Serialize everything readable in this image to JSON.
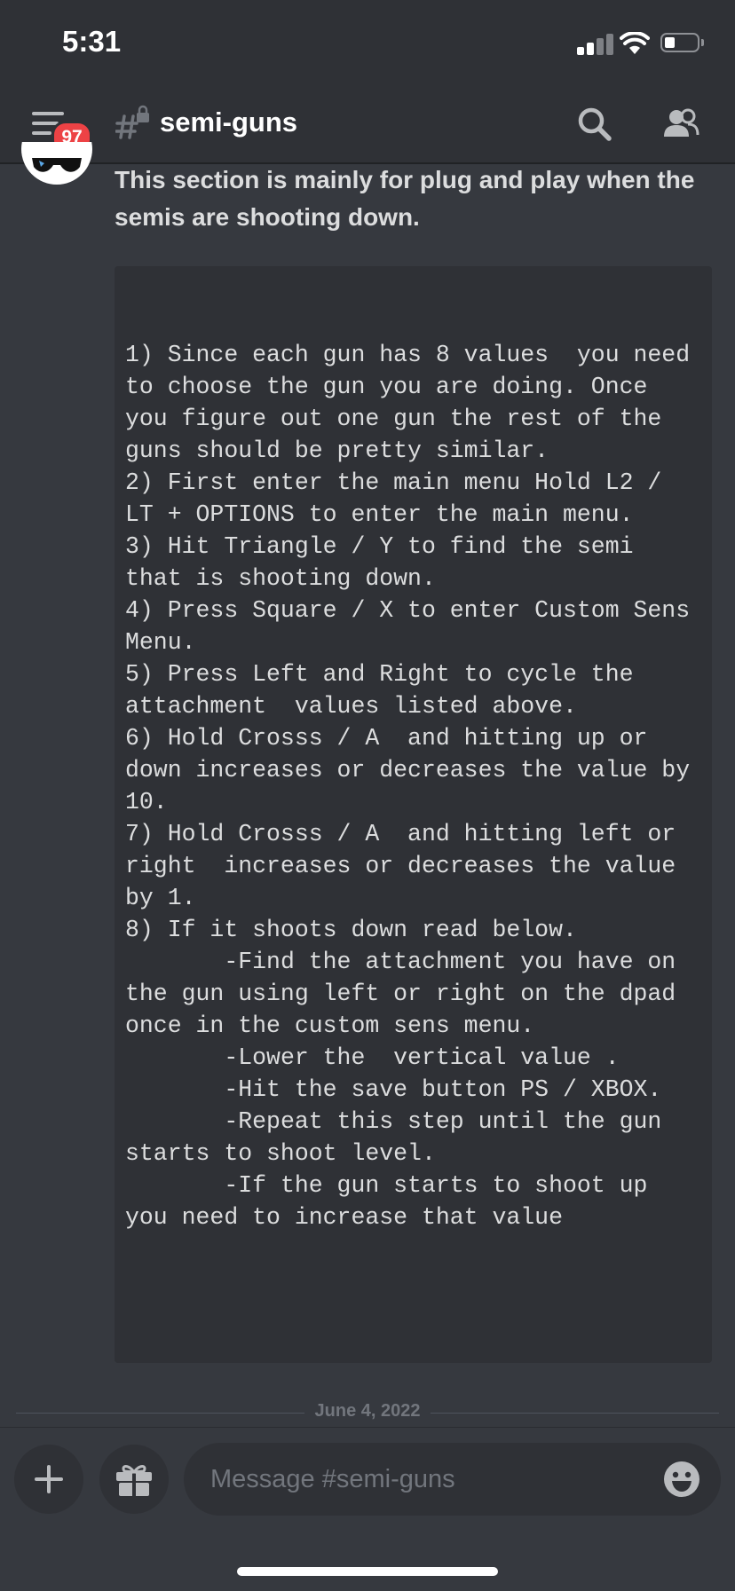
{
  "status_bar": {
    "time": "5:31"
  },
  "header": {
    "notification_count": "97",
    "channel_name": "semi-guns"
  },
  "message": {
    "text": "This section is mainly for plug and play when the semis are shooting down.",
    "code": "1) Since each gun has 8 values  you need to choose the gun you are doing. Once you figure out one gun the rest of the guns should be pretty similar.\n2) First enter the main menu Hold L2 / LT + OPTIONS to enter the main menu.\n3) Hit Triangle / Y to find the semi that is shooting down.\n4) Press Square / X to enter Custom Sens Menu.\n5) Press Left and Right to cycle the attachment  values listed above.\n6) Hold Crosss / A  and hitting up or down increases or decreases the value by 10.\n7) Hold Crosss / A  and hitting left or right  increases or decreases the value by 1.\n8) If it shoots down read below.\n       -Find the attachment you have on the gun using left or right on the dpad once in the custom sens menu.\n       -Lower the  vertical value .\n       -Hit the save button PS / XBOX.\n       -Repeat this step until the gun starts to shoot level.\n       -If the gun starts to shoot up you need to increase that value"
  },
  "date_divider": "June 4, 2022",
  "composer": {
    "placeholder": "Message #semi-guns"
  },
  "icons": {
    "menu": "hamburger-icon",
    "channel": "locked-hash-icon",
    "search": "search-icon",
    "members": "members-icon",
    "plus": "plus-icon",
    "gift": "gift-icon",
    "emoji": "emoji-icon"
  },
  "colors": {
    "background": "#36393f",
    "header": "#2f3136",
    "badge": "#ed4245",
    "text": "#dcddde"
  }
}
